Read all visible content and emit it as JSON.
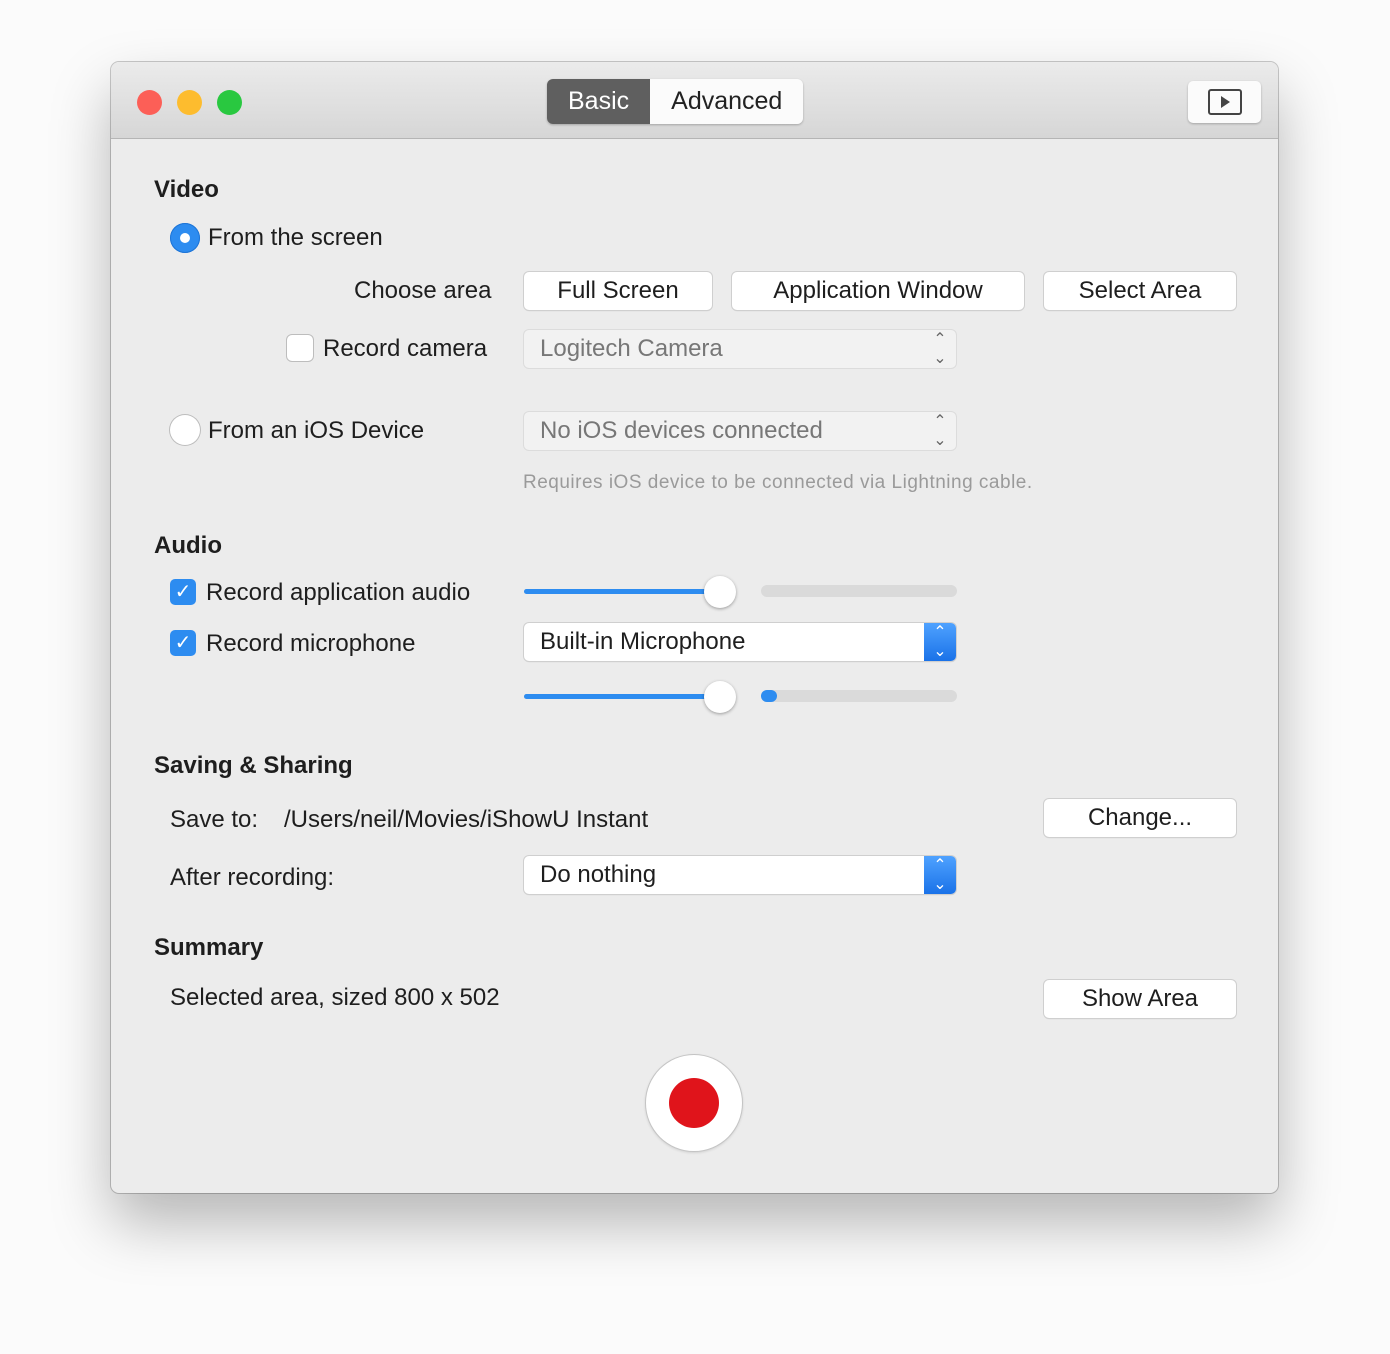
{
  "titlebar": {
    "tabs": [
      {
        "label": "Basic",
        "active": true
      },
      {
        "label": "Advanced",
        "active": false
      }
    ]
  },
  "video": {
    "heading": "Video",
    "from_screen": "From the screen",
    "choose_area": "Choose area",
    "area_buttons": [
      "Full Screen",
      "Application Window",
      "Select Area"
    ],
    "record_camera": "Record camera",
    "camera_select": "Logitech Camera",
    "from_ios": "From an iOS Device",
    "ios_select": "No iOS devices connected",
    "ios_hint": "Requires iOS device to be connected via Lightning cable."
  },
  "audio": {
    "heading": "Audio",
    "record_app_audio": "Record application audio",
    "record_mic": "Record microphone",
    "mic_select": "Built-in Microphone",
    "app_volume": 0.9,
    "app_level": 0.0,
    "mic_volume": 0.9,
    "mic_level": 0.08
  },
  "saving": {
    "heading": "Saving & Sharing",
    "save_to_label": "Save to:",
    "save_path": "/Users/neil/Movies/iShowU Instant",
    "change_button": "Change...",
    "after_label": "After recording:",
    "after_select": "Do nothing"
  },
  "summary": {
    "heading": "Summary",
    "text": "Selected area, sized 800 x 502",
    "show_area_button": "Show Area"
  },
  "colors": {
    "accent": "#2d8cf0",
    "record": "#e0141b"
  }
}
